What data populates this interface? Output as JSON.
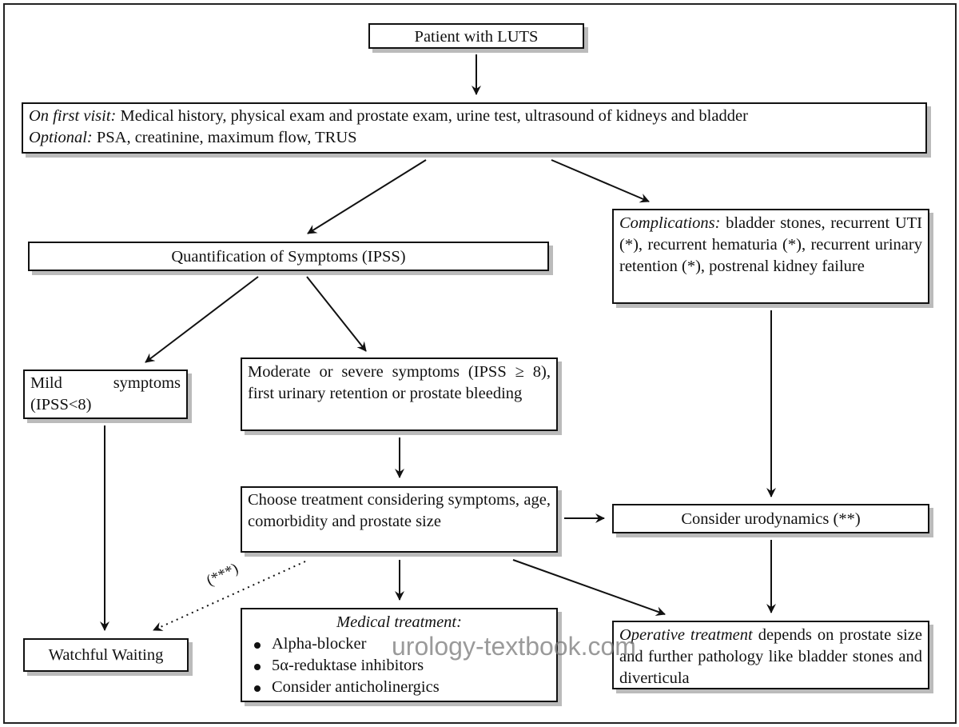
{
  "start": "Patient with LUTS",
  "first_visit": {
    "label": "On first visit:",
    "text": " Medical history, physical exam and prostate exam, urine test, ultrasound of kidneys and bladder",
    "optional_label": "Optional:",
    "optional_text": " PSA, creatinine, maximum flow, TRUS"
  },
  "quantification": "Quantification of Symptoms (IPSS)",
  "complications": {
    "label": "Complications:",
    "text": " bladder stones, recurrent UTI (*), recurrent hematuria (*), recurrent urinary retention (*), postrenal kidney failure"
  },
  "mild": "Mild symptoms (IPSS<8)",
  "moderate": "Moderate or severe symptoms (IPSS ≥ 8), first urinary retention or prostate bleeding",
  "choose": "Choose treatment considering symptoms, age, comorbidity and prostate size",
  "urodynamics": "Consider urodynamics (**)",
  "watchful": "Watchful Waiting",
  "medical": {
    "title": "Medical treatment:",
    "items": [
      "Alpha-blocker",
      "5α-reduktase inhibitors",
      "Consider anticholinergics"
    ]
  },
  "operative": {
    "label": "Operative treatment",
    "text": " depends on prostate size and further pathology like bladder stones and diverticula"
  },
  "dotted_label": "(***)",
  "watermark": "urology-textbook.com"
}
